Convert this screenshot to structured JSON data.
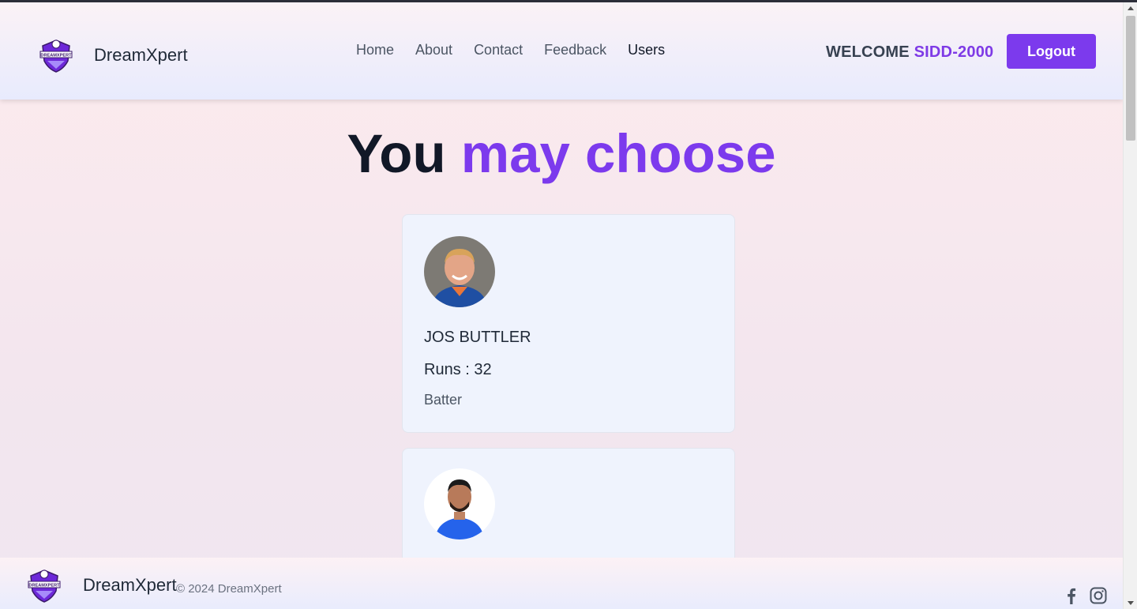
{
  "header": {
    "brand": "DreamXpert",
    "nav": [
      {
        "label": "Home"
      },
      {
        "label": "About"
      },
      {
        "label": "Contact"
      },
      {
        "label": "Feedback"
      },
      {
        "label": "Users"
      }
    ],
    "welcome_prefix": "WELCOME",
    "username": "SIDD-2000",
    "logout_label": "Logout",
    "logo_text": "DREAMXPERT"
  },
  "main": {
    "title_plain": "You",
    "title_accent": "may choose",
    "cards": [
      {
        "name": "JOS BUTTLER",
        "runs": "Runs : 32",
        "role": "Batter",
        "avatar_icon": "player-photo-icon"
      },
      {
        "avatar_icon": "player-photo-icon"
      }
    ]
  },
  "footer": {
    "brand": "DreamXpert",
    "copyright": "© 2024 DreamXpert",
    "social": [
      "facebook-icon",
      "instagram-icon"
    ]
  },
  "colors": {
    "accent": "#7c3aed",
    "header_bg": "#e8ebfd",
    "card_bg": "#eff3fd"
  }
}
